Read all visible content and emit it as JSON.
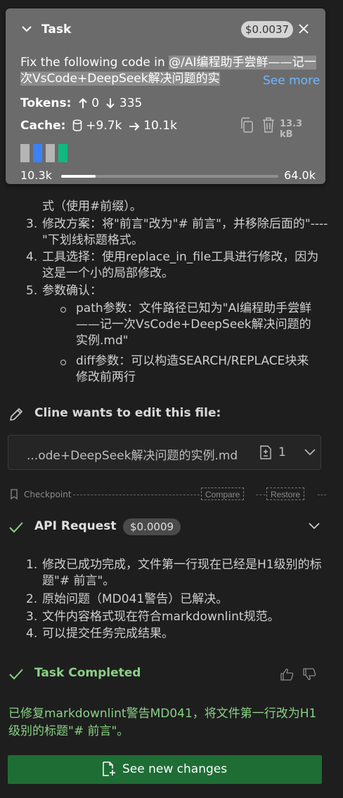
{
  "task": {
    "title": "Task",
    "cost": "$0.0037",
    "text_plain": "Fix the following code in ",
    "text_mention": "@/AI编程助手尝鲜——记一次VsCode+DeepSeek解决问题的实",
    "see_more": "See more",
    "tokens_label": "Tokens:",
    "tokens_up": "0",
    "tokens_down": "335",
    "cache_label": "Cache:",
    "cache_write": "+9.7k",
    "cache_read": "10.1k",
    "size": "13.3 kB",
    "context_min": "10.3k",
    "context_max": "64.0k",
    "context_fraction": 0.16,
    "context_blocks": [
      "#b5b5b5",
      "#3b82f6",
      "#b5b5b5",
      "#10b981"
    ]
  },
  "steps": [
    {
      "num": "",
      "text": "式（使用#前缀）。"
    },
    {
      "num": "3.",
      "text": "修改方案：将\"前言\"改为\"# 前言\"，并移除后面的\"----\"下划线标题格式。"
    },
    {
      "num": "4.",
      "text": "工具选择：使用replace_in_file工具进行修改，因为这是一个小的局部修改。"
    },
    {
      "num": "5.",
      "text": "参数确认："
    }
  ],
  "sub_steps": [
    {
      "text": "path参数：文件路径已知为\"AI编程助手尝鲜——记一次VsCode+DeepSeek解决问题的实例.md\""
    },
    {
      "text": "diff参数：可以构造SEARCH/REPLACE块来修改前两行"
    }
  ],
  "edit": {
    "title": "Cline wants to edit this file:",
    "file_name": "...ode+DeepSeek解决问题的实例.md",
    "diff_count": "1"
  },
  "checkpoint": {
    "label": "Checkpoint",
    "compare": "Compare",
    "restore": "Restore"
  },
  "api_request": {
    "title": "API Request",
    "cost": "$0.0009",
    "items": [
      {
        "num": "1.",
        "text": "修改已成功完成，文件第一行现在已经是H1级别的标题\"# 前言\"。"
      },
      {
        "num": "2.",
        "text": "原始问题（MD041警告）已解决。"
      },
      {
        "num": "3.",
        "text": "文件内容格式现在符合markdownlint规范。"
      },
      {
        "num": "4.",
        "text": "可以提交任务完成结果。"
      }
    ]
  },
  "completed": {
    "title": "Task Completed",
    "text": "已修复markdownlint警告MD041，将文件第一行改为H1级别的标题\"# 前言\"。"
  },
  "button": {
    "label": "See new changes"
  },
  "colors": {
    "accent_green": "#89d185",
    "button_green": "#1e6d35",
    "link_blue": "#6fb6ff"
  }
}
